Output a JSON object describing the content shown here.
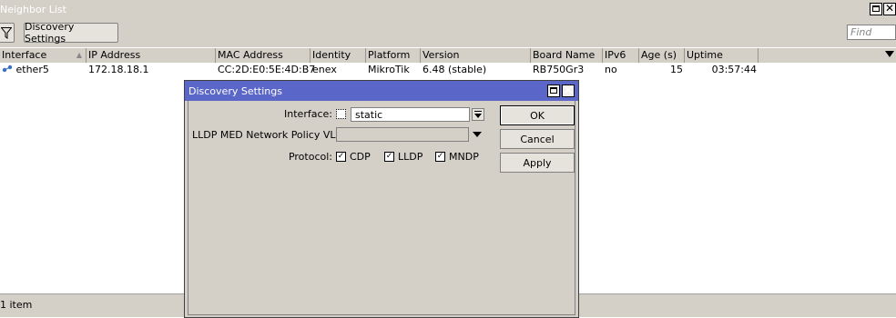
{
  "window": {
    "title": "Neighbor List"
  },
  "toolbar": {
    "filter_icon": "filter-icon",
    "discovery_settings_label": "Discovery Settings",
    "find_placeholder": "Find"
  },
  "table": {
    "columns": [
      "Interface",
      "IP Address",
      "MAC Address",
      "Identity",
      "Platform",
      "Version",
      "Board Name",
      "IPv6",
      "Age (s)",
      "Uptime"
    ],
    "rows": [
      {
        "interface": "ether5",
        "ip": "172.18.18.1",
        "mac": "CC:2D:E0:5E:4D:B7",
        "identity": "enex",
        "platform": "MikroTik",
        "version": "6.48 (stable)",
        "board": "RB750Gr3",
        "ipv6": "no",
        "age": "15",
        "uptime": "03:57:44"
      }
    ]
  },
  "status": {
    "text": "1 item"
  },
  "dialog": {
    "title": "Discovery Settings",
    "interface_label": "Interface:",
    "interface_value": "static",
    "interface_checked": false,
    "lldp_vlan_label": "LLDP MED Network Policy VLAN",
    "lldp_vlan_value": "",
    "protocol_label": "Protocol:",
    "protocols": [
      {
        "label": "CDP",
        "checked": true
      },
      {
        "label": "LLDP",
        "checked": true
      },
      {
        "label": "MNDP",
        "checked": true
      }
    ],
    "ok_label": "OK",
    "cancel_label": "Cancel",
    "apply_label": "Apply"
  }
}
